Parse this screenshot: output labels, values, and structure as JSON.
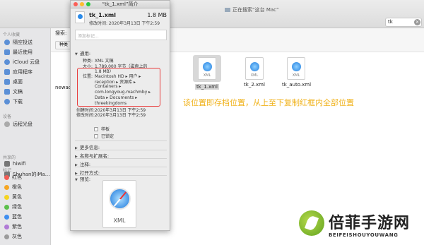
{
  "finder": {
    "title": "正在搜索“这台 Mac”",
    "search_value": "tk",
    "search_scope_label": "搜索:",
    "scope_button": "种类",
    "partial_file_name": "newac"
  },
  "sidebar": {
    "sections": [
      {
        "title": "个人收藏",
        "items": [
          "隔空投送",
          "最近使用",
          "iCloud 云盘",
          "应用程序",
          "桌面",
          "文稿",
          "下载"
        ]
      },
      {
        "title": "设备",
        "items": [
          "远程光盘"
        ]
      },
      {
        "title": "共享的",
        "items": [
          "hiwifi",
          "Shuhan的iMa..."
        ]
      },
      {
        "title": "标记",
        "items": [
          "红色",
          "橙色",
          "黄色",
          "绿色",
          "蓝色",
          "紫色",
          "灰色"
        ]
      }
    ],
    "tag_colors": [
      "#f25c54",
      "#f5a623",
      "#f5d423",
      "#5cc04b",
      "#3f8ef0",
      "#b07ad6",
      "#9b9b9b"
    ]
  },
  "files": [
    {
      "name": "tk_1.xml",
      "icon_label": "XML",
      "selected": true
    },
    {
      "name": "tk_2.xml",
      "icon_label": "XML",
      "selected": false
    },
    {
      "name": "tk_auto.xml",
      "icon_label": "XML",
      "selected": false
    }
  ],
  "annotation": "该位置即存档位置，从上至下复制红框内全部位置",
  "info": {
    "window_title": "“tk_1.xml”简介",
    "file_name": "tk_1.xml",
    "file_size": "1.8 MB",
    "modified": "修改时间: 2020年3月13日 下午2:59",
    "tag_placeholder": "添加标记...",
    "general_label": "通用:",
    "rows": [
      {
        "k": "种类:",
        "v": "XML 文稿"
      },
      {
        "k": "大小:",
        "v": "1,789,000 字节（磁盘上的"
      },
      {
        "k": "",
        "v": "1.8 MB）"
      },
      {
        "k": "位置:",
        "v": "Macintosh HD ▸ 用户 ▸"
      },
      {
        "k": "",
        "v": "reception ▸ 资源库 ▸"
      },
      {
        "k": "",
        "v": "Containers ▸"
      },
      {
        "k": "",
        "v": "com.longyoug.machmby ▸"
      },
      {
        "k": "",
        "v": "Data ▸ Documents ▸"
      },
      {
        "k": "",
        "v": "threekingdoms"
      },
      {
        "k": "创建时间:",
        "v": "2020年3月13日 下午2:59"
      },
      {
        "k": "修改时间:",
        "v": "2020年3月13日 下午2:59"
      }
    ],
    "checkbox_stationery": "样板",
    "checkbox_locked": "已锁定",
    "sections": [
      "更多信息:",
      "名称与扩展名:",
      "注释:",
      "打开方式:",
      "预览:"
    ],
    "preview_label": "XML"
  },
  "watermark": {
    "cn": "倍菲手游网",
    "en": "BEIFEISHOUYOUWANG"
  }
}
